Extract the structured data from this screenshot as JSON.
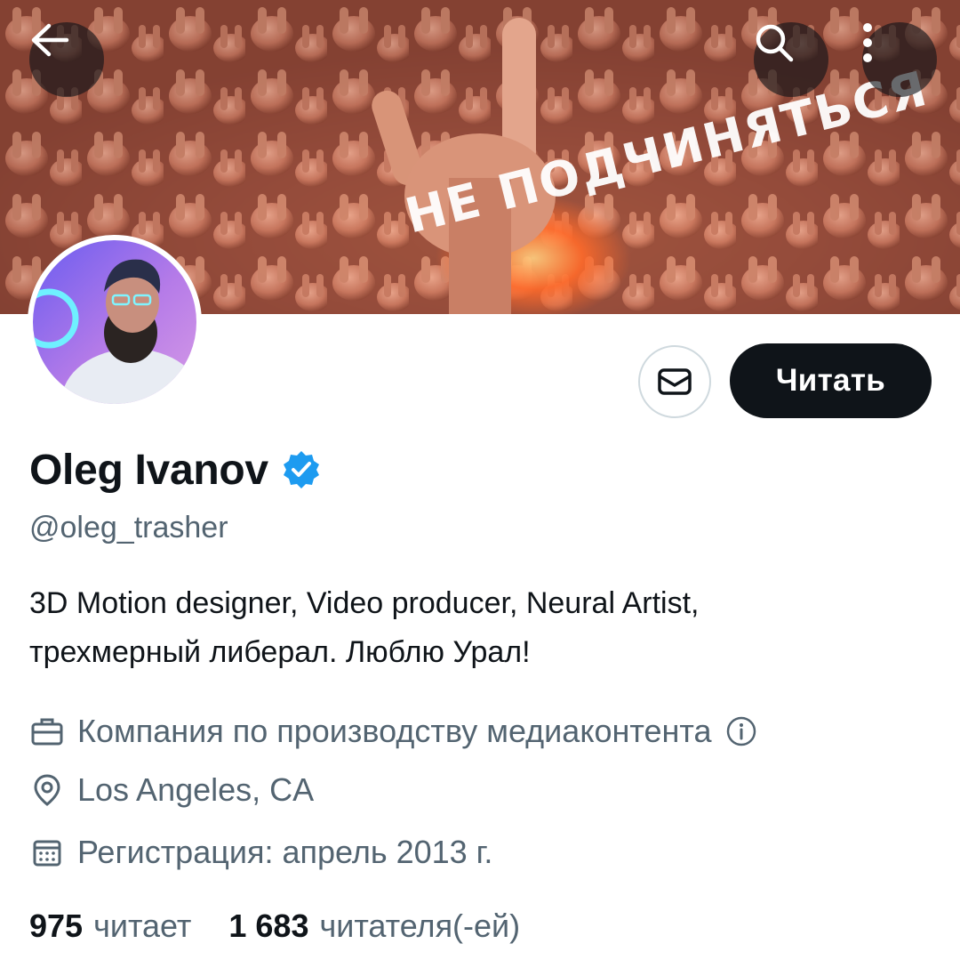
{
  "banner": {
    "overlay_text": "НЕ ПОДЧИНЯТЬСЯ",
    "back_icon": "arrow-left-icon",
    "search_icon": "search-icon",
    "more_icon": "more-vertical-icon"
  },
  "actions": {
    "message_icon": "envelope-icon",
    "follow_label": "Читать"
  },
  "profile": {
    "display_name": "Oleg Ivanov",
    "verified_icon": "verified-badge-icon",
    "handle": "@oleg_trasher",
    "bio_line1": "3D Motion designer, Video producer, Neural Artist,",
    "bio_line2": "трехмерный либерал. Люблю Урал!",
    "category": "Компания по производству медиаконтента",
    "location": "Los Angeles, CA",
    "joined": "Регистрация: апрель 2013 г."
  },
  "stats": {
    "following_count": "975",
    "following_label": "читает",
    "followers_count": "1 683",
    "followers_label": "читателя(-ей)"
  },
  "colors": {
    "text_primary": "#0f1419",
    "text_secondary": "#536471",
    "verified_blue": "#1d9bf0",
    "button_dark": "#0f1419",
    "border": "#cfd9de"
  }
}
